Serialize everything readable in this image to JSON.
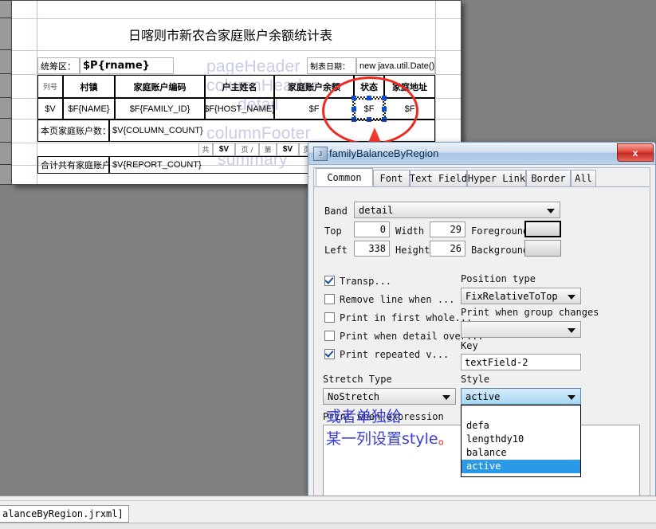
{
  "report": {
    "title": "日喀则市新农合家庭账户余额统计表",
    "watermarks": [
      {
        "text": "pageHeader"
      },
      {
        "text": "columnHeader"
      },
      {
        "text": "detail"
      },
      {
        "text": "columnFooter"
      },
      {
        "text": "summary"
      }
    ],
    "param_row": {
      "label": "统筹区：",
      "value": "$P{rname}",
      "date_label": "制表日期：",
      "date_value": "new java.util.Date()"
    },
    "column_headers": [
      "列号",
      "村镇",
      "家庭账户编码",
      "户主姓名",
      "家庭账户余额",
      "状态",
      "家庭地址"
    ],
    "detail_row": [
      "$V",
      "$F{NAME}",
      "$F{FAMILY_ID}",
      "$F{HOST_NAME}",
      "$F",
      "$F",
      "$F"
    ],
    "column_footer": {
      "label": "本页家庭账户数：",
      "value": "$V{COLUMN_COUNT}"
    },
    "page_footer": {
      "t1": "共",
      "v1": "$V",
      "t2": "页 /",
      "t3": "第",
      "v2": "$V",
      "t4": "页"
    },
    "summary": {
      "label": "合计共有家庭账户",
      "value": "$V{REPORT_COUNT}"
    }
  },
  "dialog": {
    "title": "familyBalanceByRegion",
    "close_label": "x",
    "icon": "app-icon",
    "tabs": [
      {
        "label": "Common",
        "active": true
      },
      {
        "label": "Font",
        "active": false
      },
      {
        "label": "Text Field",
        "active": false
      },
      {
        "label": "Hyper Link",
        "active": false
      },
      {
        "label": "Border",
        "active": false
      },
      {
        "label": "All",
        "active": false
      }
    ],
    "fields": {
      "band_label": "Band",
      "band_value": "detail",
      "top_label": "Top",
      "top_value": "0",
      "width_label": "Width",
      "width_value": "29",
      "foreground_label": "Foreground",
      "left_label": "Left",
      "left_value": "338",
      "height_label": "Height",
      "height_value": "26",
      "background_label": "Background"
    },
    "checkboxes": [
      {
        "label": "Transp...",
        "checked": true
      },
      {
        "label": "Remove line when ...",
        "checked": false
      },
      {
        "label": "Print in first whole...",
        "checked": false
      },
      {
        "label": "Print when detail over...",
        "checked": false
      },
      {
        "label": "Print repeated v...",
        "checked": true
      }
    ],
    "position_type_label": "Position type",
    "position_type_value": "FixRelativeToTop",
    "print_when_group_label": "Print when group changes",
    "print_when_group_value": "",
    "key_label": "Key",
    "key_value": "textField-2",
    "stretch_label": "Stretch Type",
    "stretch_value": "NoStretch",
    "style_label": "Style",
    "style_value": "active",
    "style_options": [
      "",
      "defa",
      "lengthdy10",
      "balance",
      "active"
    ],
    "style_selected_index": 4,
    "expr_label": "Print when expression"
  },
  "annotation": {
    "line1": "或者单独给",
    "line2": "某一列设置style",
    "tail": "。"
  },
  "statusbar": {
    "file_tab": "alanceByRegion.jrxml]"
  },
  "colors": {
    "annotation": "#3b40d4",
    "marker_red": "#ee2a22",
    "selection_handle": "#0a4ed6",
    "dropdown_highlight": "#2a9ae8",
    "canvas": "#808080"
  },
  "icons": {
    "play": "play-icon",
    "close": "close-icon",
    "dropdown": "chevron-down-icon"
  }
}
